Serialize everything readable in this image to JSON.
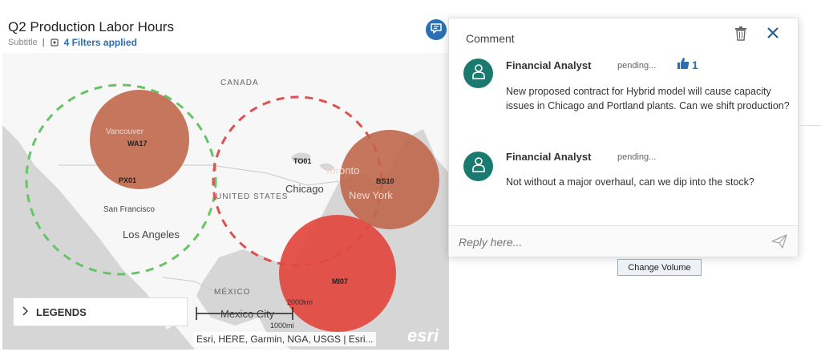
{
  "header": {
    "title": "Q2 Production Labor Hours",
    "subtitle": "Subtitle",
    "separator": "|",
    "filters_label": "4 Filters applied"
  },
  "map": {
    "region_labels": {
      "canada": "CANADA",
      "united_states": "UNITED STATES",
      "mexico": "MÉXICO"
    },
    "cities": {
      "vancouver": "Vancouver",
      "san_francisco": "San Francisco",
      "los_angeles": "Los Angeles",
      "toronto": "Toronto",
      "chicago": "Chicago",
      "new_york": "New York",
      "mexico_city": "Mexico City"
    },
    "site_codes": {
      "wa17": "WA17",
      "px01": "PX01",
      "to01": "TO01",
      "bs10": "BS10",
      "mi07": "MI07"
    },
    "scale": {
      "top": "2000km",
      "bottom": "1000mi"
    },
    "attribution": "Esri, HERE, Garmin, NGA, USGS | Esri...",
    "logo": "esri",
    "colors": {
      "ocean": "#d6d6d6",
      "land": "#f7f7f7",
      "bubble_brown": "#c0674a",
      "bubble_red": "#e2463f",
      "ring_green": "#66c466",
      "ring_red": "#e05050"
    }
  },
  "legends": {
    "label": "LEGENDS"
  },
  "comment_panel": {
    "title": "Comment",
    "comments": [
      {
        "author": "Financial Analyst",
        "status": "pending...",
        "likes": "1",
        "text": "New proposed contract for Hybrid model will cause capacity issues in Chicago and Portland plants.  Can we shift production?"
      },
      {
        "author": "Financial Analyst",
        "status": "pending...",
        "text": "Not without a major overhaul, can we dip into the stock?"
      }
    ],
    "reply_placeholder": "Reply here..."
  },
  "actions": {
    "change_volume": "Change Volume"
  },
  "theme": {
    "accent": "#2a6fb5",
    "avatar": "#1b7a70"
  }
}
